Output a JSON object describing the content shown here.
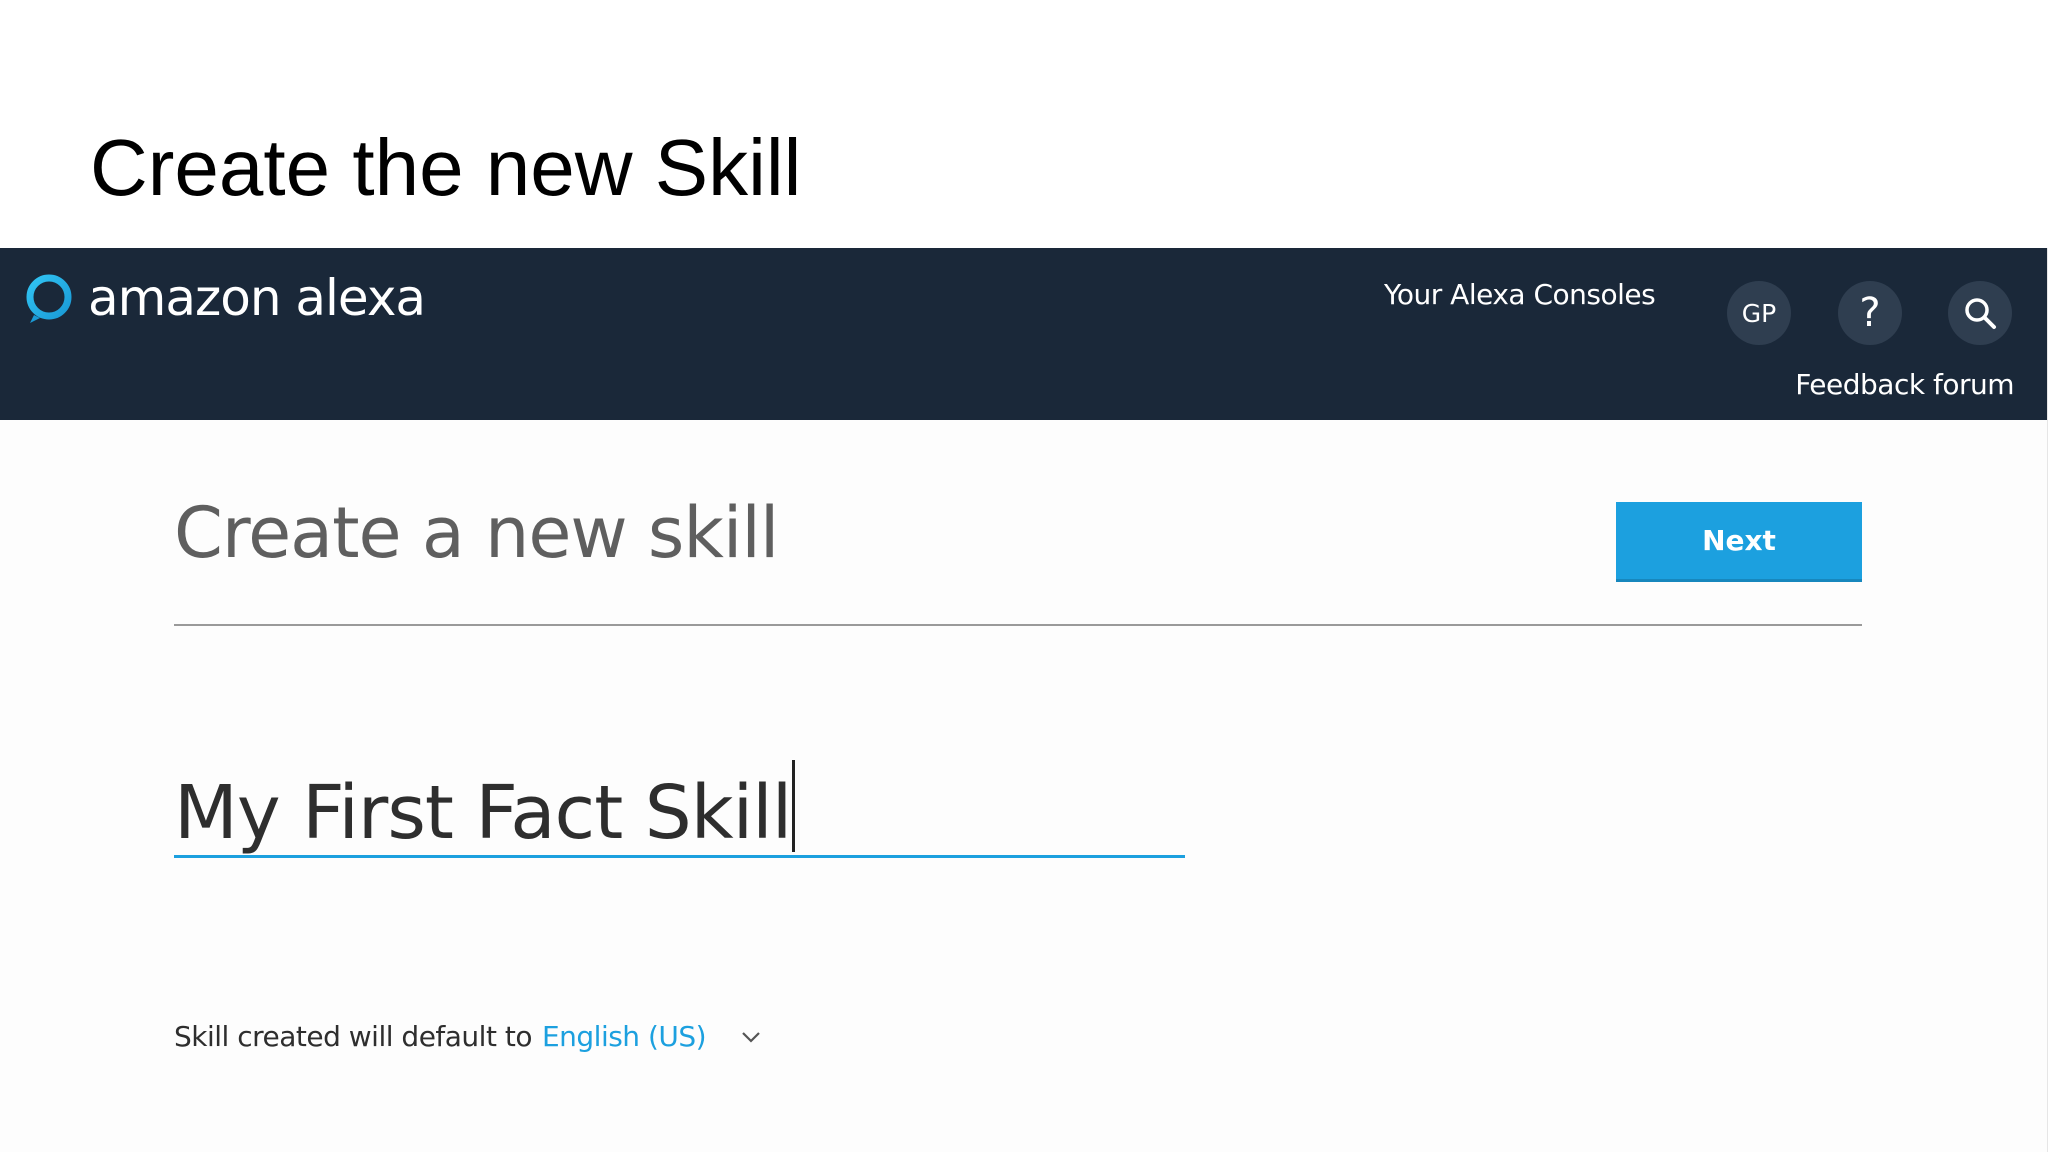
{
  "slide": {
    "title": "Create the new Skill"
  },
  "navbar": {
    "logo_text": "amazon alexa",
    "consoles_label": "Your Alexa Consoles",
    "avatar_initials": "GP",
    "help_label": "?",
    "feedback_label": "Feedback forum"
  },
  "main": {
    "heading": "Create a new skill",
    "next_label": "Next",
    "skill_name_value": "My First Fact Skill",
    "locale_prefix": "Skill created will default to",
    "locale_value": "English (US)"
  },
  "icons": {
    "logo": "alexa-ring-icon",
    "search": "search-icon",
    "dropdown": "chevron-down-icon"
  },
  "colors": {
    "navbar": "#1a2839",
    "nav_circle": "#2f3e50",
    "accent": "#1ca0df",
    "heading_text": "#5f5f5f"
  }
}
